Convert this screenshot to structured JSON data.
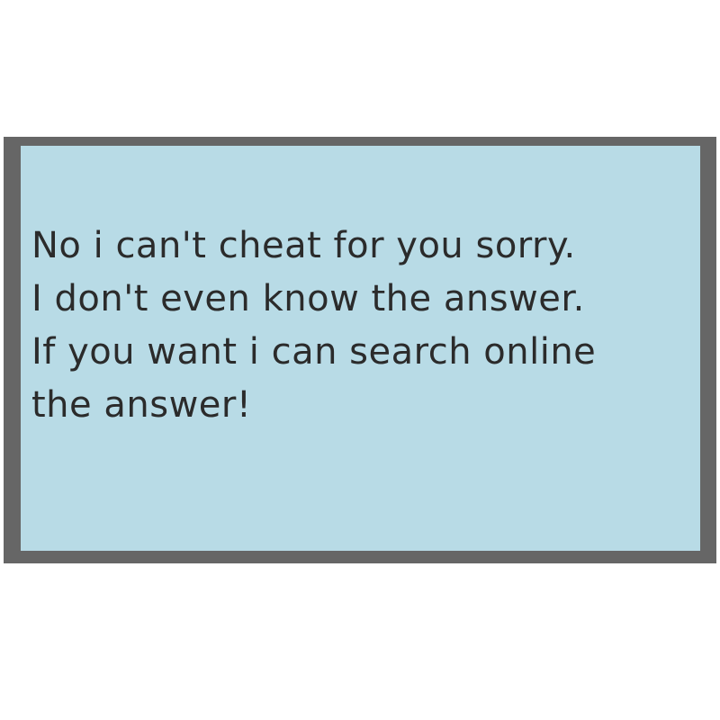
{
  "colors": {
    "page_background": "#ffffff",
    "frame_border": "#666666",
    "card_background": "#b8dbe6",
    "text": "#2b2b2b"
  },
  "message": {
    "lines": [
      "No i can't cheat for you sorry.",
      "I don't even know the answer.",
      "If you want i can search online",
      "the answer!"
    ]
  }
}
